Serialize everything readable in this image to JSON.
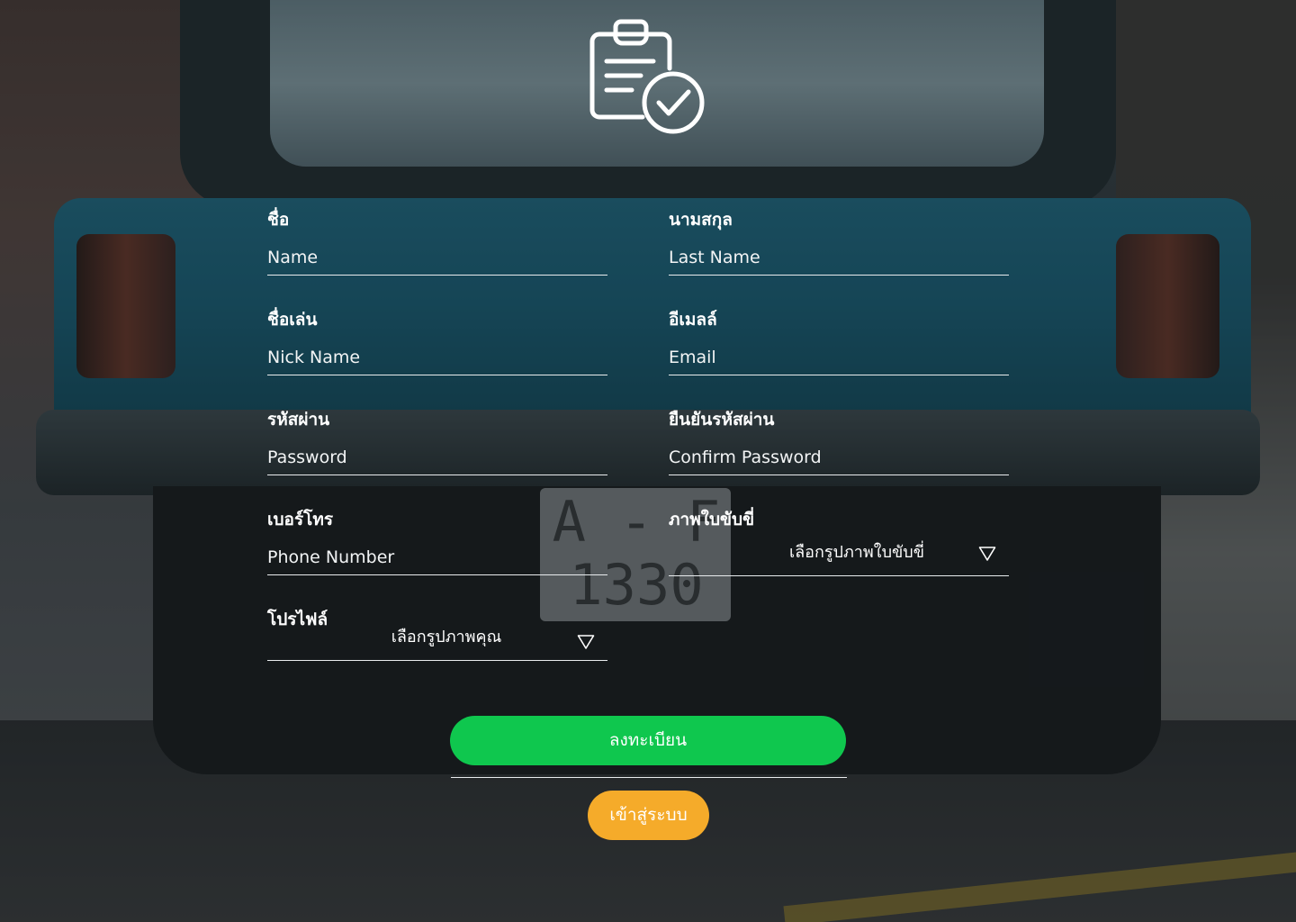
{
  "form": {
    "first_name": {
      "label": "ชื่อ",
      "placeholder": "Name"
    },
    "last_name": {
      "label": "นามสกุล",
      "placeholder": "Last Name"
    },
    "nickname": {
      "label": "ชื่อเล่น",
      "placeholder": "Nick Name"
    },
    "email": {
      "label": "อีเมลล์",
      "placeholder": "Email"
    },
    "password": {
      "label": "รหัสผ่าน",
      "placeholder": "Password"
    },
    "confirm_password": {
      "label": "ยืนยันรหัสผ่าน",
      "placeholder": "Confirm Password"
    },
    "phone": {
      "label": "เบอร์โทร",
      "placeholder": "Phone Number"
    },
    "license": {
      "label": "ภาพใบขับขี่",
      "select_text": "เลือกรูปภาพใบขับขี่"
    },
    "profile": {
      "label": "โปรไฟล์",
      "select_text": "เลือกรูปภาพคุณ"
    }
  },
  "actions": {
    "register_label": "ลงทะเบียน",
    "login_label": "เข้าสู่ระบบ"
  },
  "background": {
    "plate_text": "A - F\n1330"
  },
  "icons": {
    "logo": "clipboard-check-icon",
    "dropdown": "triangle-down-icon"
  },
  "colors": {
    "register_button": "#0fc74e",
    "login_button": "#f5ab2a",
    "text": "#ffffff",
    "underline": "#e9ecee"
  }
}
